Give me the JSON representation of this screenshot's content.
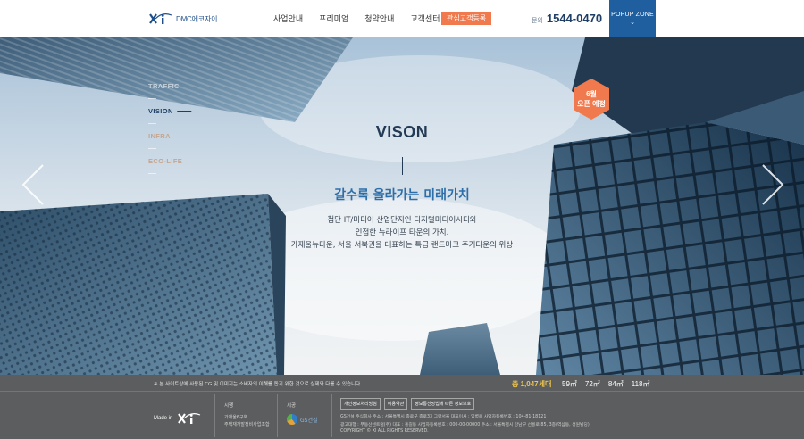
{
  "header": {
    "logo_text": "DMC에코자이",
    "nav": [
      "사업안내",
      "프리미엄",
      "청약안내",
      "고객센터"
    ],
    "register_label": "관심고객등록",
    "phone_label": "문의",
    "phone_number": "1544-0470",
    "popup_label": "POPUP ZONE",
    "popup_chevron": "⌄"
  },
  "side_nav": {
    "items": [
      "TRAFFIC",
      "VISION",
      "INFRA",
      "ECO-LIFE"
    ],
    "active": "VISION"
  },
  "badge": {
    "line1": "6월",
    "line2": "오픈 예정",
    "color": "#f07a4d"
  },
  "hero": {
    "title": "VISON",
    "subtitle": "갈수록 올라가는 미래가치",
    "desc_lines": [
      "첨단 IT/미디어 산업단지인 디지털미디어시티와",
      "인접한 뉴라이프 타운의 가치.",
      "가재울뉴타운, 서울 서북권을 대표하는 특급 랜드마크 주거타운의 위상"
    ],
    "arrow_left": "chevron-left-icon",
    "arrow_right": "chevron-right-icon"
  },
  "footer": {
    "notice": "※ 본 사이트상에 사용된 CG 및 이미지는 소비자의 이해를 돕기 위한 것으로 실제와 다를 수 있습니다.",
    "total": "총 1,047세대",
    "sizes": [
      "59㎡",
      "72㎡",
      "84㎡",
      "118㎡"
    ],
    "made_in": "Made in",
    "developer_title": "시행",
    "developer_lines": [
      "가재울6구역",
      "주택재개발정비사업조합"
    ],
    "construct_title": "시공",
    "construct_name": "GS건설",
    "links": [
      "개인정보처리방침",
      "이용약관",
      "정보통신망법에 따른 정보보호"
    ],
    "company_lines": [
      "GS건설 주식회사      주소 : 서울특별시 종로구 종로33 그랑서울      대표이사 : 임병용      사업자등록번호 : 104-81-18121",
      "광고대행 : 부동산센트럴(주)      대표 : 홍길동      사업자등록번호 : 000-00-00000      주소 : 서울특별시 강남구 선릉로 85, 3층(역삼동, 성원빌딩)",
      "COPYRIGHT © XI ALL RIGHTS RESERVED."
    ]
  },
  "colors": {
    "accent": "#1f5fa0",
    "orange": "#f07a4d",
    "navy": "#1f3e66",
    "subtitle_blue": "#2e6ea8"
  }
}
